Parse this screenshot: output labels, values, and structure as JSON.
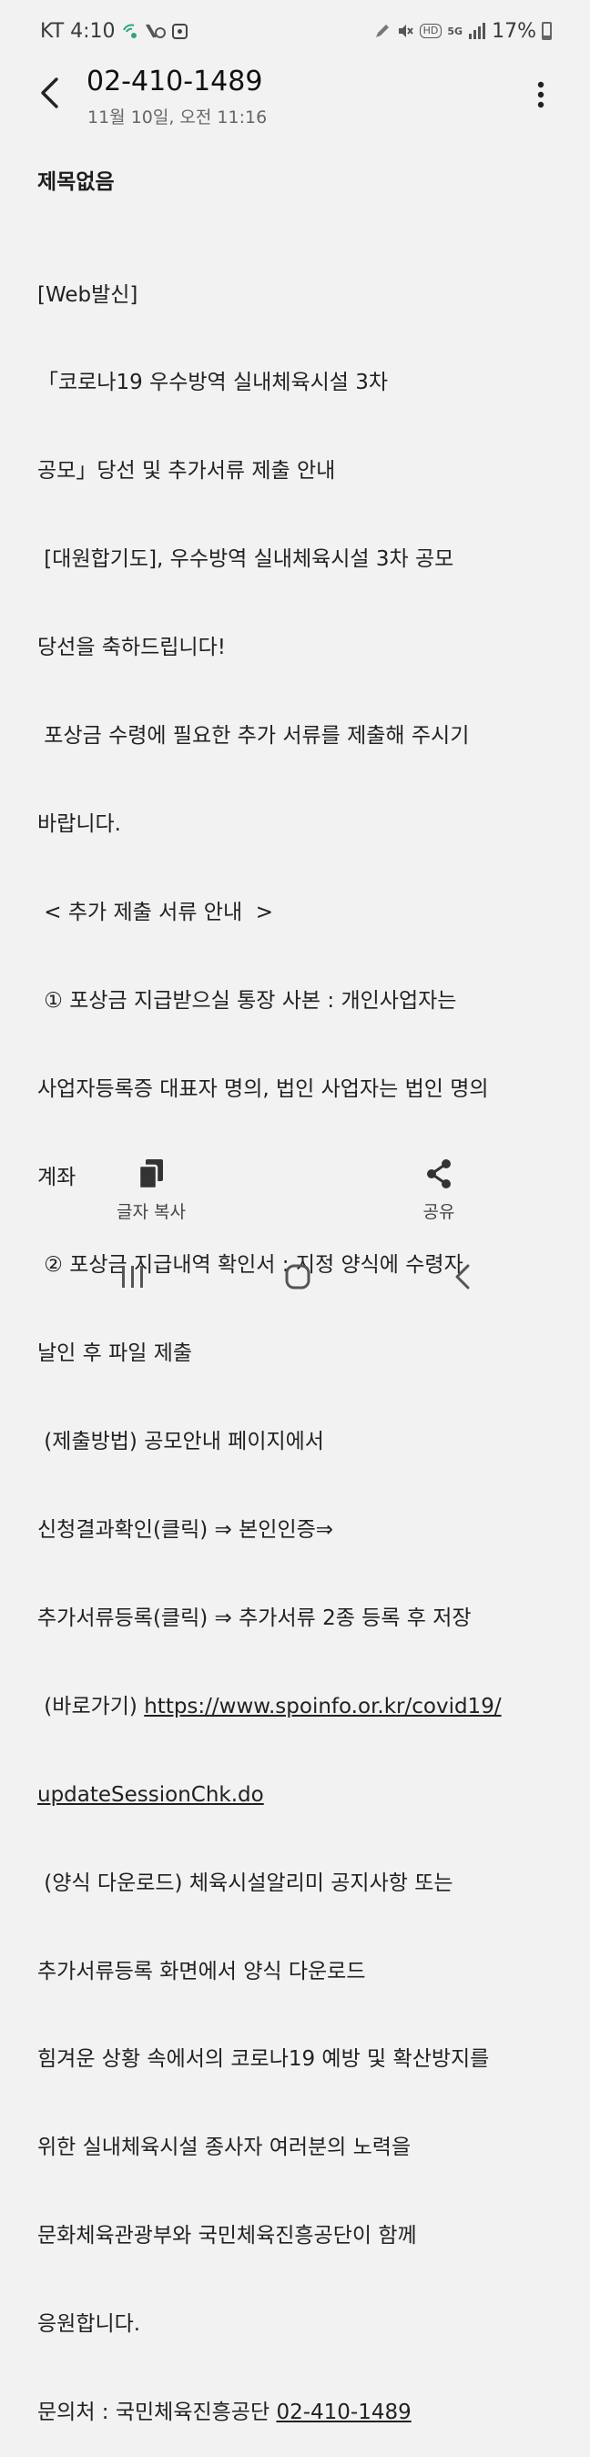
{
  "status_bar": {
    "carrier_time": "KT 4:10",
    "battery": "17%",
    "hd_badge": "HD",
    "network": "5G"
  },
  "header": {
    "title": "02-410-1489",
    "subtitle": "11월 10일, 오전 11:16"
  },
  "message": {
    "subject": "제목없음",
    "lines": [
      "[Web발신]",
      "「코로나19 우수방역 실내체육시설 3차",
      "공모」당선 및 추가서류 제출 안내",
      " [대원합기도], 우수방역 실내체육시설 3차 공모",
      "당선을 축하드립니다!",
      " 포상금 수령에 필요한 추가 서류를 제출해 주시기",
      "바랍니다.",
      " < 추가 제출 서류 안내  >",
      " ① 포상금 지급받으실 통장 사본 : 개인사업자는",
      "사업자등록증 대표자 명의, 법인 사업자는 법인 명의",
      "계좌",
      " ② 포상금 지급내역 확인서 : 지정 양식에 수령자",
      "날인 후 파일 제출",
      " (제출방법) 공모안내 페이지에서",
      "신청결과확인(클릭) ⇒ 본인인증⇒",
      "추가서류등록(클릭) ⇒ 추가서류 2종 등록 후 저장"
    ],
    "link_prefix": " (바로가기) ",
    "link_part1": "https://www.spoinfo.or.kr/covid19/",
    "link_part2": "updateSessionChk.do",
    "lines_after": [
      " (양식 다운로드) 체육시설알리미 공지사항 또는",
      "추가서류등록 화면에서 양식 다운로드",
      "힘겨운 상황 속에서의 코로나19 예방 및 확산방지를",
      "위한 실내체육시설 종사자 여러분의 노력을",
      "문화체육관광부와 국민체육진흥공단이 함께",
      "응원합니다."
    ],
    "contact_prefix": "문의처 : 국민체육진흥공단 ",
    "contact_phone": "02-410-1489"
  },
  "actions": {
    "copy_label": "글자 복사",
    "share_label": "공유"
  },
  "colors": {
    "background": "#f2f2f2",
    "text": "#1e1e1e",
    "secondary_text": "#666666"
  }
}
